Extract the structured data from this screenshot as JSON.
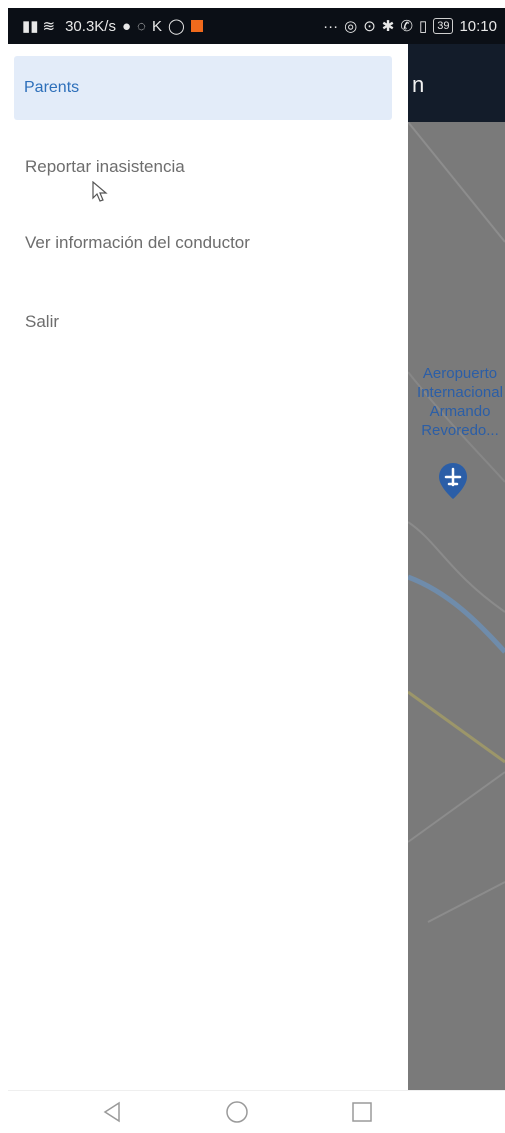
{
  "status_bar": {
    "network_speed": "30.3K/s",
    "battery": "39",
    "time": "10:10"
  },
  "app": {
    "title_fragment": "n"
  },
  "map": {
    "airport_label_lines": [
      "Aeropuerto",
      "Internacional",
      "Armando",
      "Revoredo..."
    ]
  },
  "drawer": {
    "header_label": "Parents",
    "items": [
      {
        "label": "Reportar inasistencia"
      },
      {
        "label": "Ver información del conductor"
      },
      {
        "label": "Salir"
      }
    ]
  },
  "colors": {
    "drawer_header_bg": "#e3ecf9",
    "accent": "#2d6fba",
    "map_pin": "#2b5ea7",
    "app_topbar": "#131c2a"
  },
  "icons": {
    "back": "back-triangle-icon",
    "home": "home-circle-icon",
    "recents": "recents-square-icon",
    "airport_pin": "airport-pin-icon"
  }
}
